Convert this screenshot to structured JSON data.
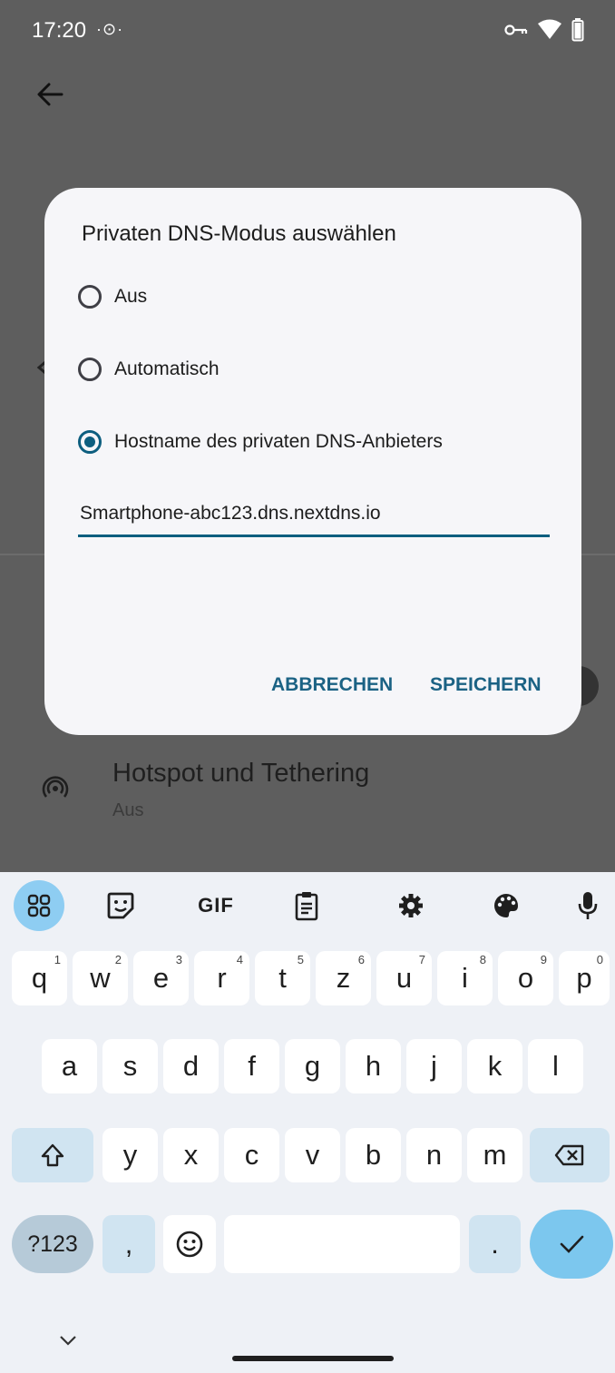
{
  "status_bar": {
    "time": "17:20",
    "extra": "·⊙·",
    "icons": [
      "vpn-key-icon",
      "wifi-icon",
      "battery-icon"
    ]
  },
  "background": {
    "hotspot_title": "Hotspot und Tethering",
    "hotspot_status": "Aus"
  },
  "dialog": {
    "title": "Privaten DNS-Modus auswählen",
    "options": [
      {
        "label": "Aus",
        "checked": false
      },
      {
        "label": "Automatisch",
        "checked": false
      },
      {
        "label": "Hostname des privaten DNS-Anbieters",
        "checked": true
      }
    ],
    "hostname_value": "Smartphone-abc123.dns.nextdns.io",
    "cancel_label": "ABBRECHEN",
    "save_label": "SPEICHERN"
  },
  "keyboard": {
    "toolbar": [
      "apps-grid-icon",
      "sticker-icon",
      "gif-icon",
      "clipboard-icon",
      "settings-icon",
      "palette-icon",
      "mic-icon"
    ],
    "gif_label": "GIF",
    "row1": [
      {
        "key": "q",
        "hint": "1"
      },
      {
        "key": "w",
        "hint": "2"
      },
      {
        "key": "e",
        "hint": "3"
      },
      {
        "key": "r",
        "hint": "4"
      },
      {
        "key": "t",
        "hint": "5"
      },
      {
        "key": "z",
        "hint": "6"
      },
      {
        "key": "u",
        "hint": "7"
      },
      {
        "key": "i",
        "hint": "8"
      },
      {
        "key": "o",
        "hint": "9"
      },
      {
        "key": "p",
        "hint": "0"
      }
    ],
    "row2": [
      "a",
      "s",
      "d",
      "f",
      "g",
      "h",
      "j",
      "k",
      "l"
    ],
    "row3": [
      "y",
      "x",
      "c",
      "v",
      "b",
      "n",
      "m"
    ],
    "sym_label": "?123",
    "comma": ",",
    "period": "."
  },
  "colors": {
    "accent": "#0d5e7f",
    "button_text": "#1b6284",
    "scrim": "#5e5e5e"
  }
}
